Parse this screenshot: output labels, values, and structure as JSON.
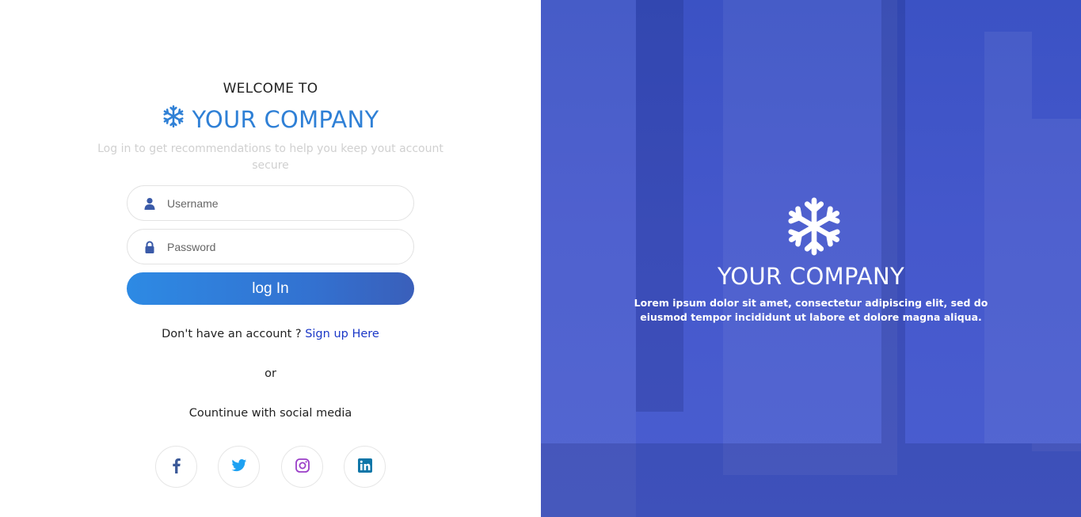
{
  "login": {
    "welcome": "WELCOME TO",
    "company": "YOUR COMPANY",
    "subtitle": "Log in to get recommendations to help you keep yout account secure",
    "username_placeholder": "Username",
    "password_placeholder": "Password",
    "login_button": "log In",
    "no_account": "Don't have an account ? ",
    "signup_link": "Sign up Here",
    "or": "or",
    "social_title": "Countinue with social media",
    "social": [
      {
        "name": "facebook-icon",
        "color": "#3b5998"
      },
      {
        "name": "twitter-icon",
        "color": "#1da1f2"
      },
      {
        "name": "instagram-icon",
        "color": "#9b3fc8"
      },
      {
        "name": "linkedin-icon",
        "color": "#0e76a8"
      }
    ]
  },
  "hero": {
    "company": "YOUR COMPANY",
    "description": "Lorem ipsum dolor sit amet, consectetur adipiscing elit, sed do eiusmod tempor incididunt ut labore et dolore magna aliqua.",
    "overlay_color": "#4558cc"
  },
  "colors": {
    "accent": "#2f80d6",
    "link": "#1a37c7",
    "icon": "#3a5aa8"
  }
}
